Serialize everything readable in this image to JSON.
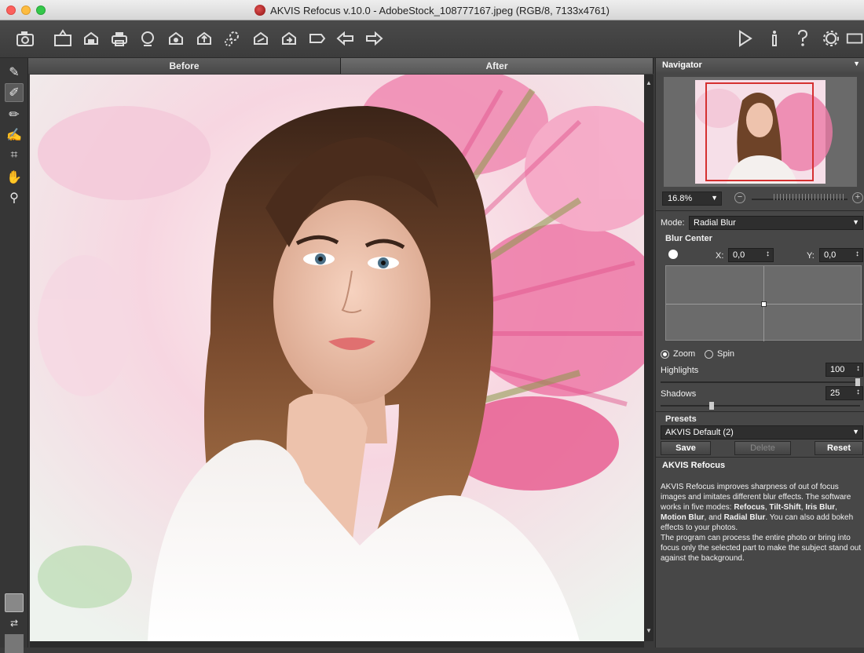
{
  "window": {
    "title": "AKVIS Refocus v.10.0 - AdobeStock_108777167.jpeg (RGB/8, 7133x4761)"
  },
  "toolbar": {
    "left_icons": [
      "camera-icon",
      "open-icon",
      "save-icon",
      "print-icon",
      "share-icon",
      "batch-icon",
      "upload-icon",
      "settings-gear-icon",
      "plugin-icon",
      "export-icon",
      "bookmark-icon",
      "undo-icon",
      "redo-icon"
    ],
    "right_icons": [
      "run-icon",
      "info-icon",
      "help-icon",
      "preferences-icon",
      "window-icon"
    ]
  },
  "tools": [
    "focus-brush-icon",
    "blur-brush-icon",
    "eraser-icon",
    "history-brush-icon",
    "crop-icon",
    "hand-icon",
    "zoom-icon"
  ],
  "tabs": {
    "before": "Before",
    "after": "After"
  },
  "navigator": {
    "title": "Navigator",
    "zoom_value": "16.8%"
  },
  "settings": {
    "mode_label": "Mode:",
    "mode_value": "Radial Blur",
    "blur_center_title": "Blur Center",
    "x_label": "X:",
    "x_value": "0,0",
    "y_label": "Y:",
    "y_value": "0,0",
    "zoom_option": "Zoom",
    "spin_option": "Spin",
    "highlights_label": "Highlights",
    "highlights_value": "100",
    "shadows_label": "Shadows",
    "shadows_value": "25"
  },
  "presets": {
    "title": "Presets",
    "selected": "AKVIS Default (2)",
    "save": "Save",
    "delete": "Delete",
    "reset": "Reset"
  },
  "info": {
    "title": "AKVIS Refocus",
    "p1": "AKVIS Refocus improves sharpness of out of focus images and imitates different blur effects. The software works in five modes: ",
    "m1": "Refocus",
    "s1": ", ",
    "m2": "Tilt-Shift",
    "s2": ", ",
    "m3": "Iris Blur",
    "s3": ", ",
    "m4": "Motion Blur",
    "s4": ", and ",
    "m5": "Radial Blur",
    "p1_end": ". You can also add bokeh effects to your photos.",
    "p2": "The program can process the entire photo or bring into focus only the selected part to make the subject stand out against the background."
  },
  "colors": {
    "panel_bg": "#474747",
    "accent_pink": "#e94f8c"
  }
}
